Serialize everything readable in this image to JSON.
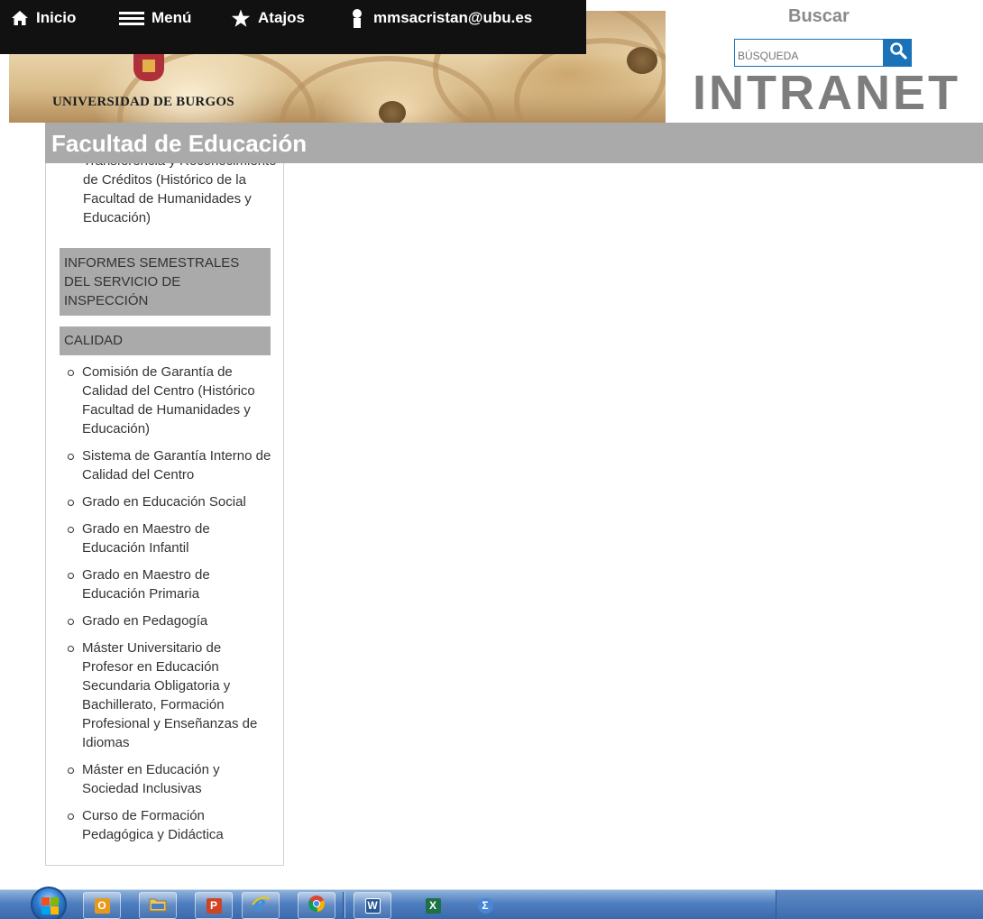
{
  "header": {
    "university_name": "UNIVERSIDAD DE BURGOS",
    "nav": {
      "home_label": "Inicio",
      "menu_label": "Menú",
      "shortcuts_label": "Atajos",
      "user_label": "mmsacristan@ubu.es"
    },
    "search": {
      "title": "Buscar",
      "placeholder": "BÚSQUEDA"
    },
    "intranet_label": "INTRANET"
  },
  "faculty": {
    "title": "Facultad de Educación"
  },
  "sidebar": {
    "fragment_text": "Transferencia y Reconocimiento de Créditos (Histórico de la Facultad de Humanidades y Educación)",
    "sections": [
      {
        "label": "INFORMES SEMESTRALES DEL SERVICIO DE INSPECCIÓN"
      },
      {
        "label": "CALIDAD"
      }
    ],
    "calidad_items": [
      "Comisión de Garantía de Calidad del Centro (Histórico Facultad de Humanidades y Educación)",
      "Sistema de Garantía Interno de Calidad del Centro",
      "Grado en Educación Social",
      "Grado en Maestro de Educación Infantil",
      "Grado en Maestro de Educación Primaria",
      "Grado en Pedagogía",
      "Máster Universitario de Profesor en Educación Secundaria Obligatoria y Bachillerato, Formación Profesional y Enseñanzas de Idiomas",
      "Máster en Educación y Sociedad Inclusivas",
      "Curso de Formación Pedagógica y Didáctica"
    ]
  },
  "taskbar": {
    "apps": [
      {
        "icon": "outlook-icon",
        "letter": "O",
        "color": "#e69a1c"
      },
      {
        "icon": "file-explorer-icon",
        "letter": "",
        "color": "#e9c46a"
      },
      {
        "icon": "powerpoint-icon",
        "letter": "P",
        "color": "#d04423"
      },
      {
        "icon": "internet-explorer-icon",
        "letter": "e",
        "color": "#3b8fe0"
      },
      {
        "icon": "chrome-icon",
        "letter": "",
        "color": "#db4437"
      },
      {
        "icon": "word-icon",
        "letter": "W",
        "color": "#2b5797"
      },
      {
        "icon": "excel-icon",
        "letter": "X",
        "color": "#1e7145"
      },
      {
        "icon": "sigma-icon",
        "letter": "Σ",
        "color": "#4a86d8"
      }
    ]
  },
  "colors": {
    "faculty_bar": "#aaaaaa",
    "search_accent": "#1a73b8",
    "topbar": "#111111"
  }
}
